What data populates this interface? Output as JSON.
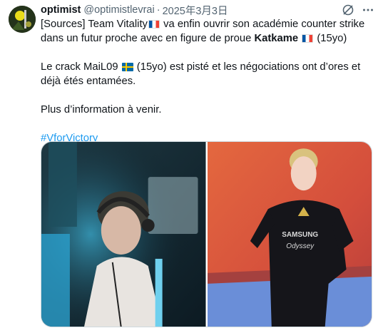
{
  "tweet": {
    "author_name": "optimist",
    "handle": "@optimistlevrai",
    "separator": "·",
    "date": "2025年3月3日",
    "line1_a": "[Sources] Team Vitality",
    "line1_b": " va enfin ouvrir son académie counter strike dans un futur proche avec en figure de proue ",
    "line1_bold": "Katkame",
    "line1_c": " (15yo)",
    "line2_a": "Le crack MaiL09 ",
    "line2_b": " (15yo) est pisté et les négociations ont d’ores et déjà étés entamées.",
    "line3": "Plus d’information à venir.",
    "hashtag": "#VforVictory"
  },
  "jersey": {
    "sponsor_top": "SAMSUNG",
    "sponsor_bottom": "Odyssey"
  },
  "icons": {
    "grok": "grok-icon",
    "more": "more-dots-icon",
    "flag_fr": "flag-france-icon",
    "flag_se": "flag-sweden-icon"
  },
  "colors": {
    "text": "#0f1419",
    "muted": "#536471",
    "link": "#1d9bf0"
  }
}
